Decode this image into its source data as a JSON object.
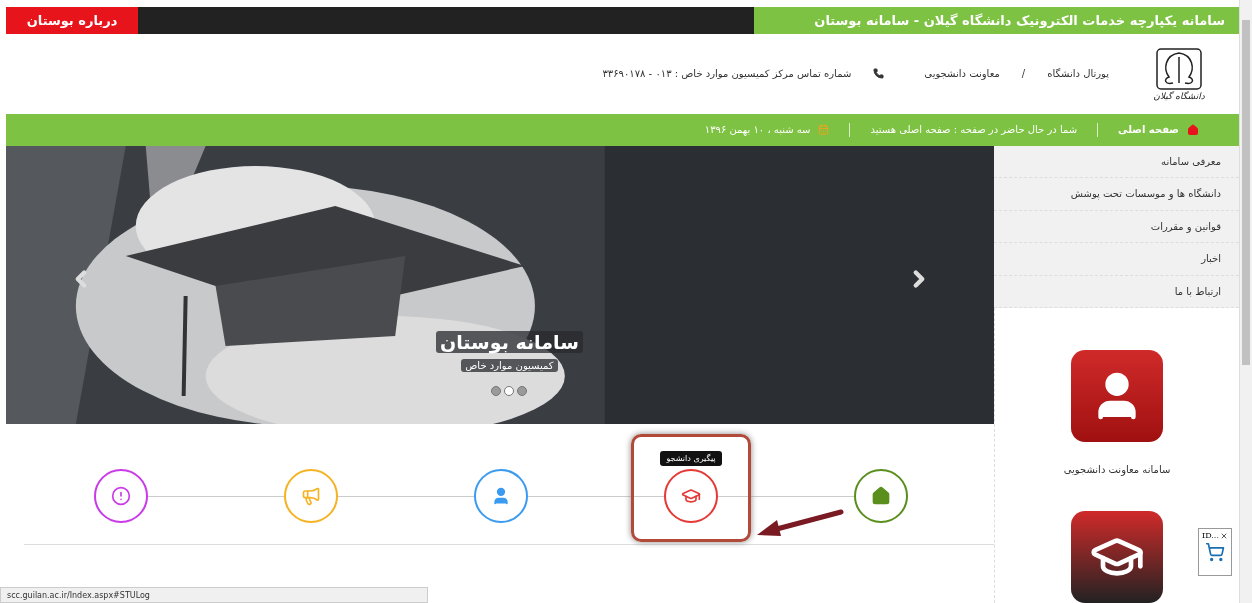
{
  "top_bar": {
    "title": "سامانه یکپارچه خدمات الکترونیک دانشگاه گیلان - سامانه بوستان",
    "about_button": "درباره بوستان"
  },
  "header": {
    "logo_caption": "دانشگاه گیلان",
    "links": [
      {
        "label": "پورتال دانشگاه"
      },
      {
        "label": "معاونت دانشجویی"
      }
    ],
    "separator": "/",
    "contact": "شماره تماس مرکز کمیسیون موارد خاص : ۰۱۳ - ۳۳۶۹۰۱۷۸"
  },
  "nav_bar": {
    "home": "صفحه اصلی",
    "location": "شما در حال حاضر در صفحه : صفحه اصلی هستید",
    "date": "سه شنبه ، ۱۰ بهمن ۱۳۹۶"
  },
  "slider": {
    "kind": "picture",
    "title": "سامانه بوستان",
    "subtitle": "کمیسیون موارد خاص",
    "dots": [
      {
        "selected": false
      },
      {
        "selected": true
      },
      {
        "selected": false
      }
    ]
  },
  "sidebar": {
    "items": [
      {
        "label": "معرفی سامانه"
      },
      {
        "label": "دانشگاه ها و موسسات تحت پوشش"
      },
      {
        "label": "قوانین و مقررات"
      },
      {
        "label": "اخبار"
      },
      {
        "label": "ارتباط با ما"
      }
    ],
    "promos": [
      {
        "kind": "student",
        "color": "#a01010",
        "label": "سامانه معاونت دانشجویی"
      },
      {
        "kind": "graduate",
        "color": "#222222"
      }
    ]
  },
  "steps": [
    {
      "kind": "home",
      "color": "#5a8f1e",
      "selected": false
    },
    {
      "kind": "graduate",
      "color": "#e53935",
      "selected": true,
      "tooltip": "پیگیری دانشجو"
    },
    {
      "kind": "user",
      "color": "#3a9bf0",
      "selected": false
    },
    {
      "kind": "megaphone",
      "color": "#f5b324",
      "selected": false
    },
    {
      "kind": "alert",
      "color": "#c93ae8",
      "selected": false
    }
  ],
  "status_bar": {
    "url": "scc.guilan.ac.ir/Index.aspx#STULog"
  },
  "widget": {
    "title": "ID..."
  }
}
